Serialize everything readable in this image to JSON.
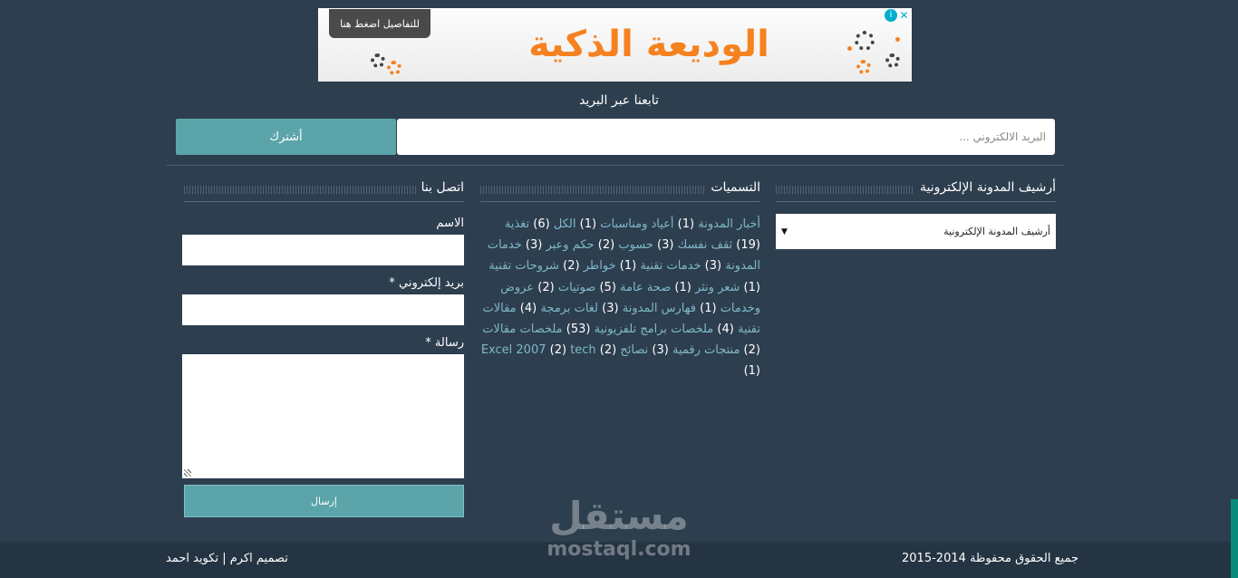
{
  "ad": {
    "cta": "للتفاصيل اضغط هنا",
    "title": "الوديعة الذكية",
    "info_icon": "info-icon",
    "close_icon": "close-icon",
    "accent_color": "#f5821f"
  },
  "subscribe": {
    "title": "تابعنا عبر البريد",
    "placeholder": "البريد الالكتروني ...",
    "button": "أشترك"
  },
  "archive": {
    "title": "أرشيف المدونة الإلكترونية",
    "selected": "أرشيف المدونة الإلكترونية"
  },
  "labels": {
    "title": "التسميات",
    "items": [
      {
        "name": "أخبار المدونة",
        "count": "(1)"
      },
      {
        "name": "أعياد ومناسبات",
        "count": "(1)"
      },
      {
        "name": "الكل",
        "count": "(6)"
      },
      {
        "name": "تغذية",
        "count": "(19)"
      },
      {
        "name": "ثقف نفسك",
        "count": "(3)"
      },
      {
        "name": "حسوب",
        "count": "(2)"
      },
      {
        "name": "حكم وعبر",
        "count": "(3)"
      },
      {
        "name": "خدمات المدونة",
        "count": "(3)"
      },
      {
        "name": "خدمات تقنية",
        "count": "(1)"
      },
      {
        "name": "خواطر",
        "count": "(2)"
      },
      {
        "name": "شروحات تقنية",
        "count": "(1)"
      },
      {
        "name": "شعر ونثر",
        "count": "(1)"
      },
      {
        "name": "صحة عامة",
        "count": "(5)"
      },
      {
        "name": "صوتيات",
        "count": "(2)"
      },
      {
        "name": "عروض وخدمات",
        "count": "(1)"
      },
      {
        "name": "فهارس المدونة",
        "count": "(3)"
      },
      {
        "name": "لغات برمجة",
        "count": "(4)"
      },
      {
        "name": "مقالات تقنية",
        "count": "(4)"
      },
      {
        "name": "ملخصات برامج تلفزيونية",
        "count": "(53)"
      },
      {
        "name": "ملخصات مقالات",
        "count": "(2)"
      },
      {
        "name": "منتجات رقمية",
        "count": "(3)"
      },
      {
        "name": "نصائح",
        "count": "(2)"
      },
      {
        "name": "Excel 2007",
        "count": "(2)"
      },
      {
        "name": "tech",
        "count": "(1)"
      }
    ]
  },
  "contact": {
    "title": "اتصل بنا",
    "name_label": "الاسم",
    "email_label": "بريد إلكتروني *",
    "message_label": "رسالة *",
    "send": "إرسال"
  },
  "footer": {
    "copyright": "جميع الحقوق محفوظة 2014-2015",
    "credits": "تصميم اكرم   |   تكويد احمد"
  },
  "watermark": {
    "arabic": "مستقل",
    "latin": "mostaql.com"
  }
}
